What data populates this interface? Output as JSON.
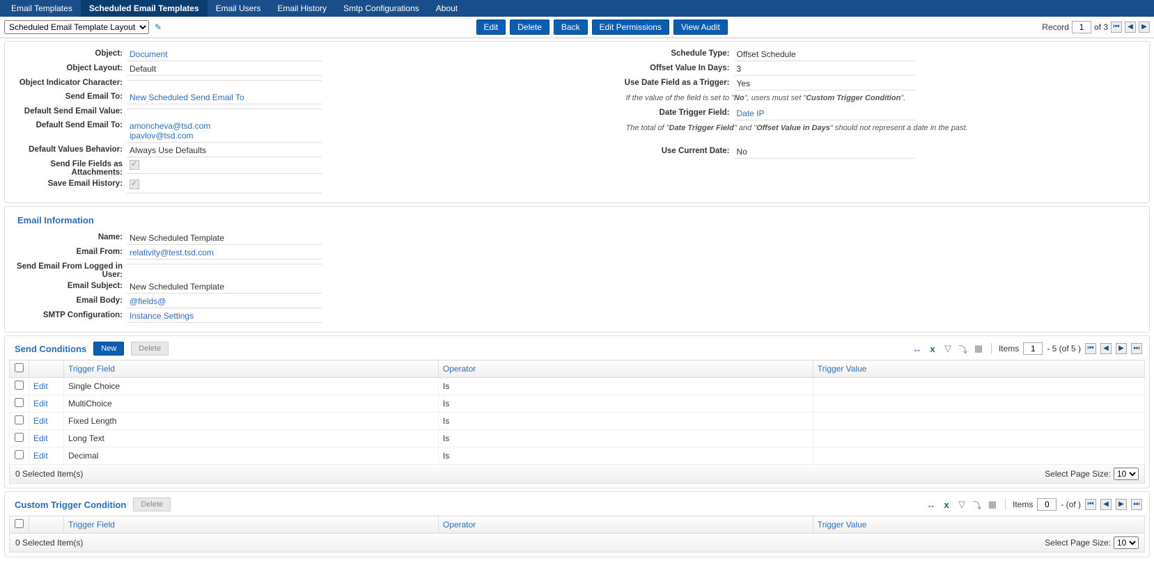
{
  "nav": {
    "items": [
      "Email Templates",
      "Scheduled Email Templates",
      "Email Users",
      "Email History",
      "Smtp Configurations",
      "About"
    ],
    "activeIndex": 1
  },
  "toolbar": {
    "layoutSelect": "Scheduled Email Template Layout",
    "buttons": {
      "edit": "Edit",
      "delete": "Delete",
      "back": "Back",
      "editPerms": "Edit Permissions",
      "viewAudit": "View Audit"
    },
    "record": {
      "label": "Record",
      "current": "1",
      "of": "of 3"
    }
  },
  "main": {
    "left": {
      "object": {
        "label": "Object:",
        "value": "Document"
      },
      "objectLayout": {
        "label": "Object Layout:",
        "value": "Default"
      },
      "indicator": {
        "label": "Object Indicator Character:",
        "value": ""
      },
      "sendTo": {
        "label": "Send Email To:",
        "value": "New Scheduled Send Email To"
      },
      "defaultSendVal": {
        "label": "Default Send Email Value:",
        "value": ""
      },
      "defaultSendTo": {
        "label": "Default Send Email To:",
        "v1": "amoncheva@tsd.com",
        "v2": "ipavlov@tsd.com"
      },
      "defaultBehavior": {
        "label": "Default Values Behavior:",
        "value": "Always Use Defaults"
      },
      "sendFile": {
        "label": "Send File Fields as Attachments:"
      },
      "saveHistory": {
        "label": "Save Email History:"
      }
    },
    "right": {
      "scheduleType": {
        "label": "Schedule Type:",
        "value": "Offset Schedule"
      },
      "offsetDays": {
        "label": "Offset Value In Days:",
        "value": "3"
      },
      "useDateTrigger": {
        "label": "Use Date Field as a Trigger:",
        "value": "Yes"
      },
      "note1a": "If the value of the field is set to \"",
      "note1b": "No",
      "note1c": "\", users must set \"",
      "note1d": "Custom Trigger Condition",
      "note1e": "\".",
      "dateTriggerField": {
        "label": "Date Trigger Field:",
        "value": "Date IP"
      },
      "note2a": "The total of \"",
      "note2b": "Date Trigger Field",
      "note2c": "\" and \"",
      "note2d": "Offset Value in Days",
      "note2e": "\" should not represent a date in the past.",
      "useCurrentDate": {
        "label": "Use Current Date:",
        "value": "No"
      }
    }
  },
  "emailInfo": {
    "title": "Email Information",
    "name": {
      "label": "Name:",
      "value": "New Scheduled Template"
    },
    "from": {
      "label": "Email From:",
      "value": "relativity@test.tsd.com"
    },
    "fromLogged": {
      "label": "Send Email From Logged in User:",
      "value": ""
    },
    "subject": {
      "label": "Email Subject:",
      "value": "New Scheduled Template"
    },
    "body": {
      "label": "Email Body:",
      "value": "@fields@"
    },
    "smtp": {
      "label": "SMTP Configuration:",
      "value": "Instance Settings"
    }
  },
  "sendCond": {
    "title": "Send Conditions",
    "newBtn": "New",
    "deleteBtn": "Delete",
    "itemsLabel": "Items",
    "itemsCurrent": "1",
    "itemsRange": "- 5 (of 5 )",
    "headers": {
      "trigger": "Trigger Field",
      "operator": "Operator",
      "value": "Trigger Value"
    },
    "editLabel": "Edit",
    "rows": [
      {
        "trigger": "Single Choice",
        "operator": "Is",
        "value": ""
      },
      {
        "trigger": "MultiChoice",
        "operator": "Is",
        "value": ""
      },
      {
        "trigger": "Fixed Length",
        "operator": "Is",
        "value": ""
      },
      {
        "trigger": "Long Text",
        "operator": "Is",
        "value": ""
      },
      {
        "trigger": "Decimal",
        "operator": "Is",
        "value": ""
      }
    ],
    "selected": "0  Selected Item(s)",
    "pageSizeLabel": "Select Page Size:",
    "pageSize": "10"
  },
  "customCond": {
    "title": "Custom Trigger Condition",
    "deleteBtn": "Delete",
    "itemsLabel": "Items",
    "itemsCurrent": "0",
    "itemsRange": "-   (of  )",
    "headers": {
      "trigger": "Trigger Field",
      "operator": "Operator",
      "value": "Trigger Value"
    },
    "selected": "0  Selected Item(s)",
    "pageSizeLabel": "Select Page Size:",
    "pageSize": "10"
  }
}
